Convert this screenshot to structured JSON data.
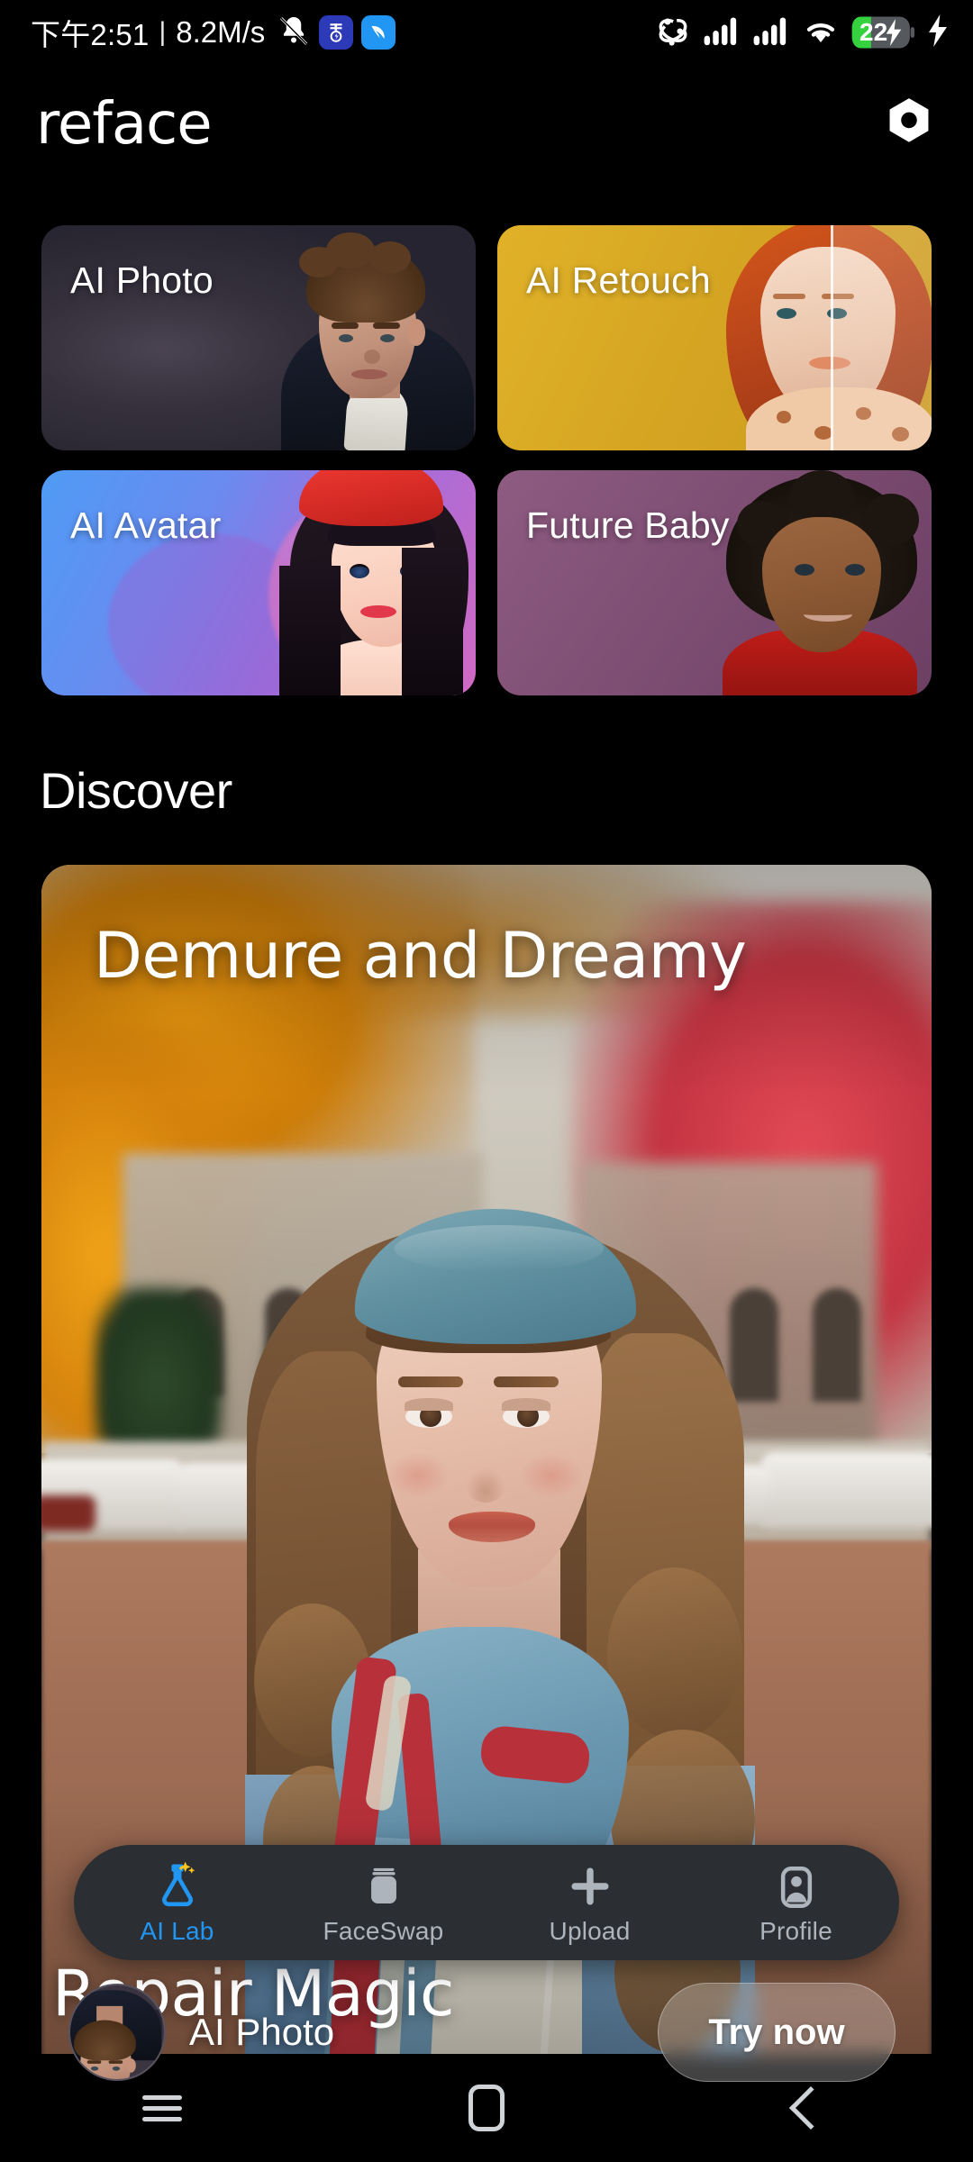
{
  "status_bar": {
    "time": "下午2:51",
    "separator": "|",
    "network_speed": "8.2M/s",
    "icons": [
      "bell-muted-icon",
      "app-badge-icon",
      "app-blue-icon",
      "atom-vpn-icon",
      "signal-bars-1-icon",
      "signal-bars-2-icon",
      "wifi-icon",
      "battery-icon",
      "charging-bolt-icon"
    ],
    "battery_percent": "22",
    "battery_color": "#35d13f",
    "charging": true
  },
  "header": {
    "brand": "reface",
    "settings_icon": "hexagon-nut-icon"
  },
  "features": {
    "cards": [
      {
        "label": "AI Photo",
        "theme": "#3a3442"
      },
      {
        "label": "AI Retouch",
        "theme": "#d3a321"
      },
      {
        "label": "AI Avatar",
        "theme": "#6a8bf0"
      },
      {
        "label": "Future Baby",
        "theme": "#7f4f74"
      }
    ]
  },
  "discover": {
    "section_title": "Discover",
    "hero": {
      "title": "Demure and Dreamy",
      "tool_label": "AI Photo",
      "cta_label": "Try now",
      "avatar_icon": "ai-photo-thumbnail"
    },
    "next": {
      "title": "Repair Magic"
    }
  },
  "bottom_nav": {
    "active_color": "#2196f3",
    "inactive_color": "#aeb4bb",
    "items": [
      {
        "label": "AI Lab",
        "icon": "flask-sparkle-icon",
        "active": true
      },
      {
        "label": "FaceSwap",
        "icon": "jar-canister-icon",
        "active": false
      },
      {
        "label": "Upload",
        "icon": "plus-icon",
        "active": false
      },
      {
        "label": "Profile",
        "icon": "person-square-icon",
        "active": false
      }
    ]
  },
  "android_nav": {
    "items": [
      {
        "label": "recents",
        "icon": "hamburger-icon"
      },
      {
        "label": "home",
        "icon": "home-square-icon"
      },
      {
        "label": "back",
        "icon": "back-chevron-icon"
      }
    ]
  }
}
